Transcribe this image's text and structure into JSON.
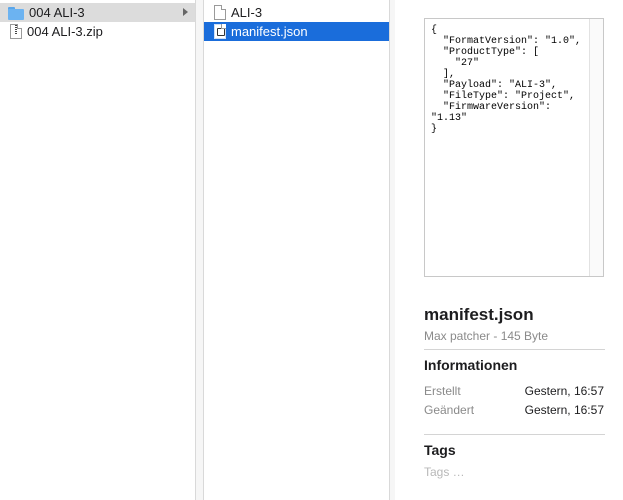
{
  "column1": {
    "items": [
      {
        "label": "004 ALI-3",
        "icon": "folder-icon",
        "selected": true,
        "has_children": true
      },
      {
        "label": "004 ALI-3.zip",
        "icon": "zip-file-icon",
        "selected": false,
        "has_children": false
      }
    ]
  },
  "column2": {
    "items": [
      {
        "label": "ALI-3",
        "icon": "document-icon",
        "selected": false
      },
      {
        "label": "manifest.json",
        "icon": "json-file-icon",
        "selected": true
      }
    ]
  },
  "preview": {
    "content": "{\n  \"FormatVersion\": \"1.0\",\n  \"ProductType\": [\n    \"27\"\n  ],\n  \"Payload\": \"ALI-3\",\n  \"FileType\": \"Project\",\n  \"FirmwareVersion\":\n\"1.13\"\n}",
    "file_name": "manifest.json",
    "file_subtitle": "Max patcher - 145 Byte",
    "info_title": "Informationen",
    "info": [
      {
        "key": "Erstellt",
        "value": "Gestern, 16:57"
      },
      {
        "key": "Geändert",
        "value": "Gestern, 16:57"
      }
    ],
    "tags_title": "Tags",
    "tags_placeholder": "Tags …"
  },
  "colors": {
    "selection_blue": "#1a6ddb",
    "selection_gray": "#dcdcdc",
    "folder_blue": "#6cb3f1"
  }
}
